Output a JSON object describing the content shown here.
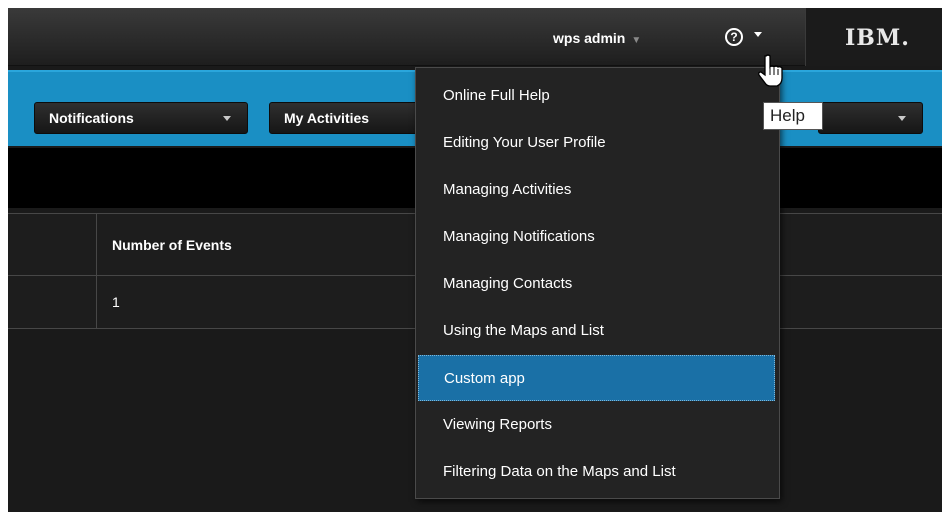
{
  "header": {
    "user_name": "wps admin",
    "user_caret": "▼",
    "help_glyph": "?",
    "logo": "IBM."
  },
  "toolbar": {
    "notifications_label": "Notifications",
    "activities_label": "My Activities"
  },
  "table": {
    "column_header": "Number of Events",
    "rows": [
      {
        "events": "1"
      }
    ]
  },
  "help_menu": {
    "items": [
      {
        "label": "Online Full Help"
      },
      {
        "label": "Editing Your User Profile"
      },
      {
        "label": "Managing Activities"
      },
      {
        "label": "Managing Notifications"
      },
      {
        "label": "Managing Contacts"
      },
      {
        "label": "Using the Maps and List"
      },
      {
        "label": "Custom app",
        "active": true
      },
      {
        "label": "Viewing Reports"
      },
      {
        "label": "Filtering Data on the Maps and List"
      }
    ]
  },
  "tooltip": {
    "text": "Help"
  },
  "colors": {
    "accent_blue": "#1a8fc4",
    "menu_highlight": "#1a70a6",
    "background_dark": "#1a1a1a"
  }
}
